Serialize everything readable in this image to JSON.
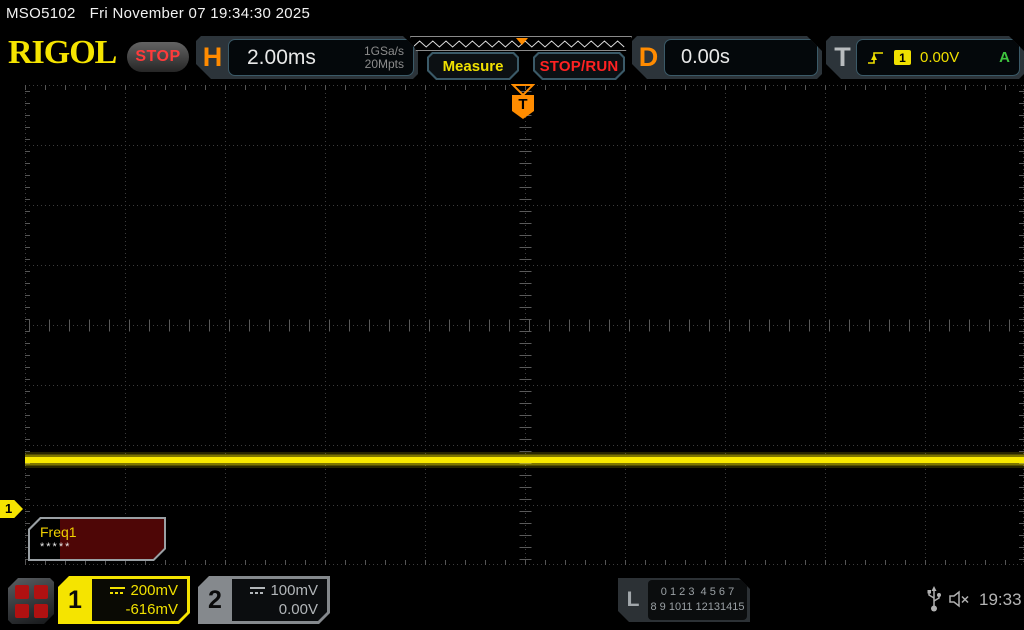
{
  "header": {
    "model": "MSO5102",
    "datetime": "Fri November 07 19:34:30 2025"
  },
  "toolbar": {
    "brand": "RIGOL",
    "run_state": "STOP",
    "horizontal": {
      "label": "H",
      "timebase": "2.00ms",
      "sample_rate": "1GSa/s",
      "memory_depth": "20Mpts"
    },
    "measure_button": "Measure",
    "stop_run_button": "STOP/RUN",
    "delay": {
      "label": "D",
      "value": "0.00s"
    },
    "trigger": {
      "label": "T",
      "source": "1",
      "level": "0.00V",
      "mode": "A"
    }
  },
  "graticule": {
    "trigger_marker": "T",
    "ch1_marker": "1",
    "divisions": {
      "horizontal": 10,
      "vertical": 8
    },
    "trace": {
      "channel": 1,
      "shape": "flat-dc-line",
      "color": "#f5e400"
    }
  },
  "measurement": {
    "name": "Freq1",
    "value": "*****"
  },
  "bottom_bar": {
    "ch1": {
      "number": "1",
      "coupling": "DC",
      "scale": "200mV",
      "offset": "-616mV"
    },
    "ch2": {
      "number": "2",
      "coupling": "DC",
      "scale": "100mV",
      "offset": "0.00V"
    },
    "logic": {
      "label": "L",
      "row1": "0 1 2 3  4 5 6 7",
      "row2": "8 9 1011 12131415"
    },
    "clock": "19:33"
  },
  "colors": {
    "channel1_yellow": "#f5e400",
    "channel2_gray": "#9aa0a4",
    "trigger_orange": "#ff8c00",
    "stop_red": "#ff3232",
    "auto_green": "#3ec43e"
  }
}
